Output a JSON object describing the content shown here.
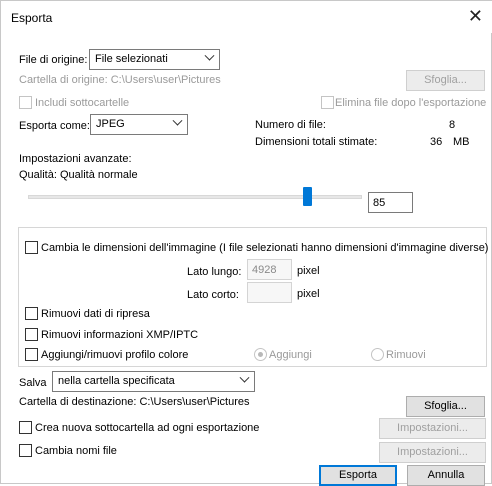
{
  "window": {
    "title": "Esporta",
    "close_icon": "close-icon"
  },
  "source": {
    "label": "File di origine:",
    "selected": "File selezionati",
    "folder_label": "Cartella di origine: C:\\Users\\user\\Pictures",
    "browse_label": "Sfoglia...",
    "include_subfolders": "Includi sottocartelle",
    "delete_after": "Elimina file dopo l'esportazione"
  },
  "export_as": {
    "label": "Esporta come:",
    "selected": "JPEG",
    "file_count_label": "Numero di file:",
    "file_count_value": "8",
    "size_label": "Dimensioni totali stimate:",
    "size_value": "36",
    "size_unit": "MB"
  },
  "advanced": {
    "label": "Impostazioni avanzate:",
    "quality_label": "Qualità: Qualità normale",
    "quality_value": "85",
    "quality_fraction": 0.85
  },
  "options": {
    "resize_label": "Cambia le dimensioni dell'immagine (I file selezionati hanno dimensioni d'immagine diverse)",
    "long_side_label": "Lato lungo:",
    "long_side_value": "4928",
    "long_side_unit": "pixel",
    "short_side_label": "Lato corto:",
    "short_side_value": "",
    "short_side_unit": "pixel",
    "remove_shooting_data": "Rimuovi dati di ripresa",
    "remove_xmp": "Rimuovi informazioni XMP/IPTC",
    "color_profile": "Aggiungi/rimuovi profilo colore",
    "radio_add": "Aggiungi",
    "radio_remove": "Rimuovi"
  },
  "save": {
    "label": "Salva",
    "selected": "nella cartella specificata",
    "dest_label": "Cartella di destinazione: C:\\Users\\user\\Pictures",
    "browse_label": "Sfoglia...",
    "create_subfolder": "Crea nuova sottocartella ad ogni esportazione",
    "settings1": "Impostazioni...",
    "rename_files": "Cambia nomi file",
    "settings2": "Impostazioni..."
  },
  "footer": {
    "export": "Esporta",
    "cancel": "Annulla"
  }
}
